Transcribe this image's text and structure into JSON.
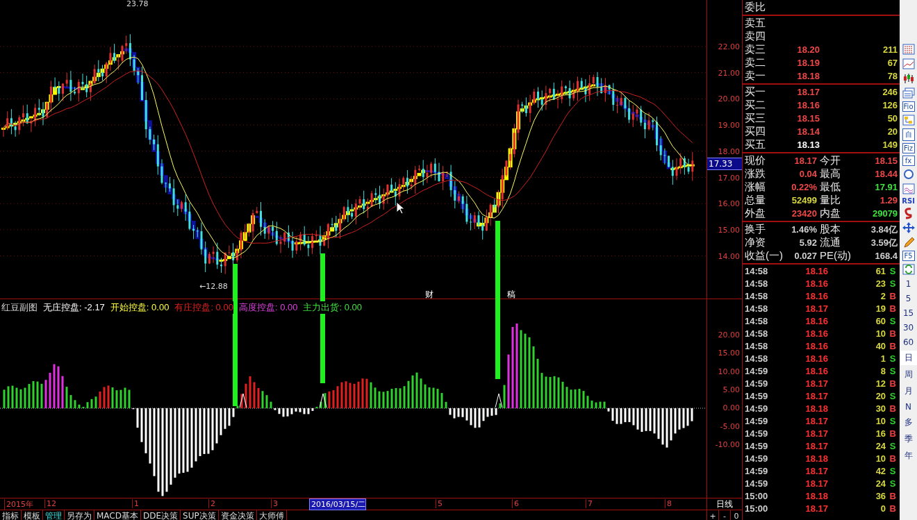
{
  "price_chart": {
    "axis_labels": [
      "22.00",
      "21.00",
      "20.00",
      "19.00",
      "18.00",
      "17.00",
      "16.00",
      "15.00",
      "14.00"
    ],
    "current_price_tag": "17.33",
    "annotations": [
      {
        "text": "23.78"
      },
      {
        "text": "←12.88"
      }
    ],
    "markers": [
      "财",
      "稿"
    ]
  },
  "indicator": {
    "legend": [
      {
        "text": "红豆副图",
        "color": "#d8d8d8"
      },
      {
        "text": "无庄控盘: -2.17",
        "color": "#ffffff"
      },
      {
        "text": "开始控盘: 0.00",
        "color": "#ffff40"
      },
      {
        "text": "有庄控盘: 0.00",
        "color": "#e02020"
      },
      {
        "text": "高度控盘: 0.00",
        "color": "#e040e0"
      },
      {
        "text": "主力出货: 0.00",
        "color": "#40e040"
      }
    ],
    "axis_labels": [
      "20.00",
      "15.00",
      "10.00",
      "5.00",
      "0.00",
      "-5.00",
      "-10.00"
    ]
  },
  "date_axis": {
    "labels": [
      {
        "text": "2015年",
        "selected": false
      },
      {
        "text": "12",
        "selected": false
      },
      {
        "text": "1",
        "selected": false
      },
      {
        "text": "2",
        "selected": false
      },
      {
        "text": "3",
        "selected": false
      },
      {
        "text": "2016/03/15/二",
        "selected": true
      },
      {
        "text": "5",
        "selected": false
      },
      {
        "text": "6",
        "selected": false
      },
      {
        "text": "7",
        "selected": false
      },
      {
        "text": "8",
        "selected": false
      }
    ],
    "period": "日线"
  },
  "tabs": [
    {
      "label": "指标",
      "selected": false
    },
    {
      "label": "模板",
      "selected": false
    },
    {
      "label": "管理",
      "selected": true
    },
    {
      "label": "另存为",
      "selected": false
    },
    {
      "label": "MACD基本",
      "selected": false
    },
    {
      "label": "DDE决策",
      "selected": false
    },
    {
      "label": "SUP决策",
      "selected": false
    },
    {
      "label": "资金决策",
      "selected": false
    },
    {
      "label": "大师傅",
      "selected": false
    }
  ],
  "zoom_buttons": [
    "+",
    "-",
    "0"
  ],
  "quote": {
    "header": "委比",
    "sells": [
      {
        "label": "卖五"
      },
      {
        "label": "卖四"
      },
      {
        "label": "卖三",
        "price": "18.20",
        "volume": "211"
      },
      {
        "label": "卖二",
        "price": "18.19",
        "volume": "67"
      },
      {
        "label": "卖一",
        "price": "18.18",
        "volume": "78"
      }
    ],
    "buys": [
      {
        "label": "买一",
        "price": "18.17",
        "volume": "246",
        "color": "#f04848"
      },
      {
        "label": "买二",
        "price": "18.16",
        "volume": "126",
        "color": "#f04848"
      },
      {
        "label": "买三",
        "price": "18.15",
        "volume": "50",
        "color": "#f04848"
      },
      {
        "label": "买四",
        "price": "18.14",
        "volume": "20",
        "color": "#f04848"
      },
      {
        "label": "买五",
        "price": "18.13",
        "volume": "149",
        "color": "#ffffff"
      }
    ],
    "stats": [
      {
        "cells": [
          {
            "label": "现价",
            "value": "18.17",
            "color": "#f04848"
          },
          {
            "label": "今开",
            "value": "18.15",
            "color": "#f04848"
          }
        ]
      },
      {
        "cells": [
          {
            "label": "涨跌",
            "value": "0.04",
            "color": "#f04848"
          },
          {
            "label": "最高",
            "value": "18.44",
            "color": "#f04848"
          }
        ]
      },
      {
        "cells": [
          {
            "label": "涨幅",
            "value": "0.22%",
            "color": "#f04848"
          },
          {
            "label": "最低",
            "value": "17.91",
            "color": "#40e040"
          }
        ]
      },
      {
        "cells": [
          {
            "label": "总量",
            "value": "52499",
            "color": "#d8d840"
          },
          {
            "label": "量比",
            "value": "1.29",
            "color": "#f04848"
          }
        ]
      },
      {
        "cells": [
          {
            "label": "外盘",
            "value": "23420",
            "color": "#f04848"
          },
          {
            "label": "内盘",
            "value": "29079",
            "color": "#40e040"
          }
        ]
      }
    ],
    "fundamentals": [
      {
        "label": "换手",
        "value": "1.46%",
        "label2": "股本",
        "value2": "3.84亿"
      },
      {
        "label": "净资",
        "value": "5.92",
        "label2": "流通",
        "value2": "3.59亿"
      },
      {
        "label": "收益(一)",
        "value": "0.027",
        "label2": "PE(动)",
        "value2": "168.4"
      }
    ],
    "ticks": [
      {
        "time": "14:58",
        "price": "18.16",
        "volume": "61",
        "side": "S",
        "kind": "sell"
      },
      {
        "time": "14:58",
        "price": "18.16",
        "volume": "23",
        "side": "S",
        "kind": "sell"
      },
      {
        "time": "14:58",
        "price": "18.16",
        "volume": "2",
        "side": "B",
        "kind": "buy"
      },
      {
        "time": "14:58",
        "price": "18.17",
        "volume": "19",
        "side": "B",
        "kind": "buy"
      },
      {
        "time": "14:58",
        "price": "18.16",
        "volume": "60",
        "side": "S",
        "kind": "sell"
      },
      {
        "time": "14:58",
        "price": "18.16",
        "volume": "10",
        "side": "B",
        "kind": "buy"
      },
      {
        "time": "14:58",
        "price": "18.16",
        "volume": "40",
        "side": "B",
        "kind": "buy"
      },
      {
        "time": "14:58",
        "price": "18.16",
        "volume": "1",
        "side": "S",
        "kind": "sell"
      },
      {
        "time": "14:59",
        "price": "18.16",
        "volume": "8",
        "side": "S",
        "kind": "sell"
      },
      {
        "time": "14:59",
        "price": "18.17",
        "volume": "12",
        "side": "B",
        "kind": "buy"
      },
      {
        "time": "14:59",
        "price": "18.17",
        "volume": "20",
        "side": "S",
        "kind": "sell"
      },
      {
        "time": "14:59",
        "price": "18.18",
        "volume": "30",
        "side": "B",
        "kind": "buy"
      },
      {
        "time": "14:59",
        "price": "18.17",
        "volume": "10",
        "side": "S",
        "kind": "sell"
      },
      {
        "time": "14:59",
        "price": "18.17",
        "volume": "16",
        "side": "B",
        "kind": "buy"
      },
      {
        "time": "14:59",
        "price": "18.17",
        "volume": "24",
        "side": "S",
        "kind": "sell"
      },
      {
        "time": "14:59",
        "price": "18.18",
        "volume": "10",
        "side": "B",
        "kind": "buy"
      },
      {
        "time": "14:59",
        "price": "18.17",
        "volume": "42",
        "side": "S",
        "kind": "sell"
      },
      {
        "time": "14:59",
        "price": "18.17",
        "volume": "24",
        "side": "S",
        "kind": "sell"
      },
      {
        "time": "15:00",
        "price": "18.18",
        "volume": "36",
        "side": "B",
        "kind": "buy"
      },
      {
        "time": "15:00",
        "price": "18.17",
        "volume": "0",
        "side": "B",
        "kind": "buy"
      }
    ]
  },
  "toolbar": {
    "items": [
      {
        "kind": "icon"
      },
      {
        "kind": "icon"
      },
      {
        "kind": "icon"
      },
      {
        "kind": "icon"
      },
      {
        "kind": "boxed",
        "label": "Fio"
      },
      {
        "kind": "icon"
      },
      {
        "kind": "boxed",
        "label": "自"
      },
      {
        "kind": "boxed",
        "label": "Fiz"
      },
      {
        "kind": "boxed",
        "label": "fx"
      },
      {
        "kind": "icon"
      },
      {
        "kind": "icon"
      },
      {
        "kind": "text",
        "label": "RSI"
      },
      {
        "kind": "icon"
      },
      {
        "kind": "icon"
      },
      {
        "kind": "icon"
      },
      {
        "kind": "boxed",
        "label": "F5"
      },
      {
        "kind": "icon"
      }
    ],
    "periods": [
      {
        "label": "1",
        "selected": false
      },
      {
        "label": "5",
        "selected": false
      },
      {
        "label": "15",
        "selected": false
      },
      {
        "label": "30",
        "selected": false
      },
      {
        "label": "60",
        "selected": false
      },
      {
        "label": "日",
        "selected": true
      },
      {
        "label": "周",
        "selected": false
      },
      {
        "label": "月",
        "selected": false
      },
      {
        "label": "N",
        "selected": false
      },
      {
        "label": "多",
        "selected": false
      },
      {
        "label": "季",
        "selected": false
      },
      {
        "label": "年",
        "selected": false
      }
    ]
  }
}
